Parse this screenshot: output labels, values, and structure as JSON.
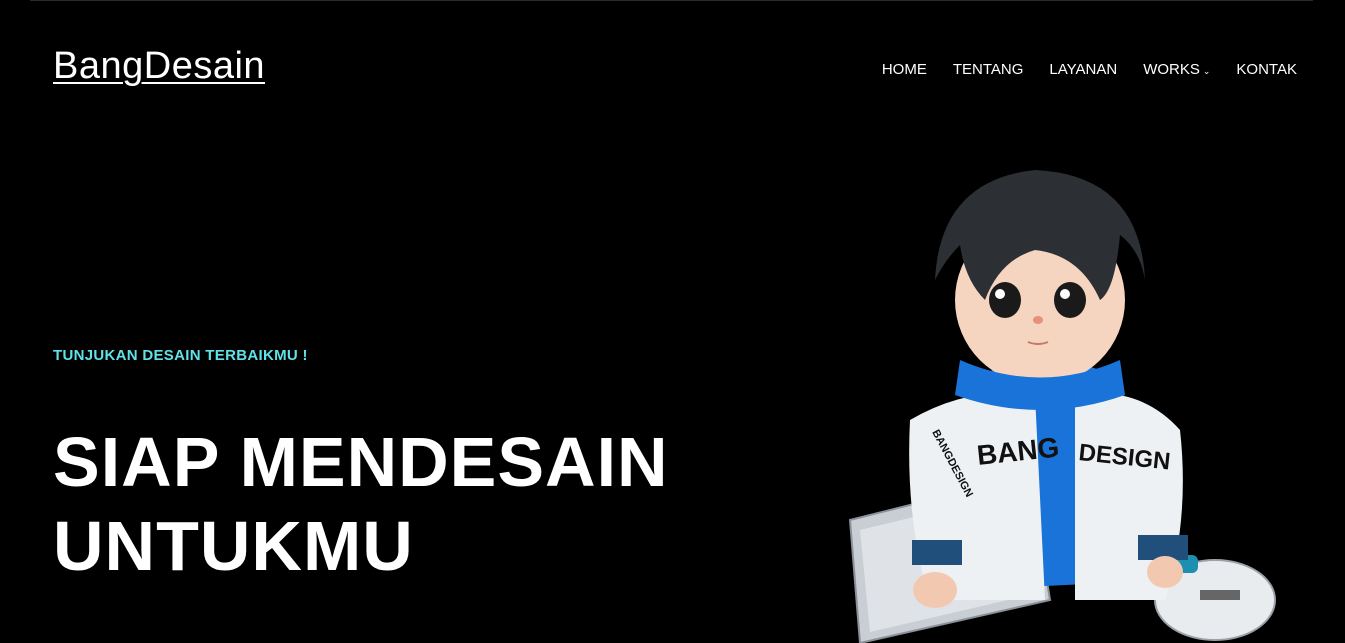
{
  "header": {
    "logo": "BangDesain",
    "nav": [
      {
        "label": "HOME"
      },
      {
        "label": "TENTANG"
      },
      {
        "label": "LAYANAN"
      },
      {
        "label": "WORKS",
        "has_dropdown": true
      },
      {
        "label": "KONTAK"
      }
    ]
  },
  "hero": {
    "tagline": "TUNJUKAN DESAIN TERBAIKMU !",
    "headline_line1": "SIAP MENDESAIN",
    "headline_line2": "UNTUKMU",
    "illustration": {
      "jacket_text_front_left": "BANG",
      "jacket_text_front_right": "DESIGN",
      "jacket_text_sleeve": "BANGDESIGN",
      "description_icons": [
        "character-illustration",
        "laptop-icon",
        "skateboard-icon"
      ]
    }
  },
  "colors": {
    "background": "#000000",
    "text": "#ffffff",
    "accent": "#5fe3e8",
    "hoodie_blue": "#1a73d9",
    "jacket_white": "#eef1f4",
    "skate_wheel": "#1e8fb0"
  }
}
